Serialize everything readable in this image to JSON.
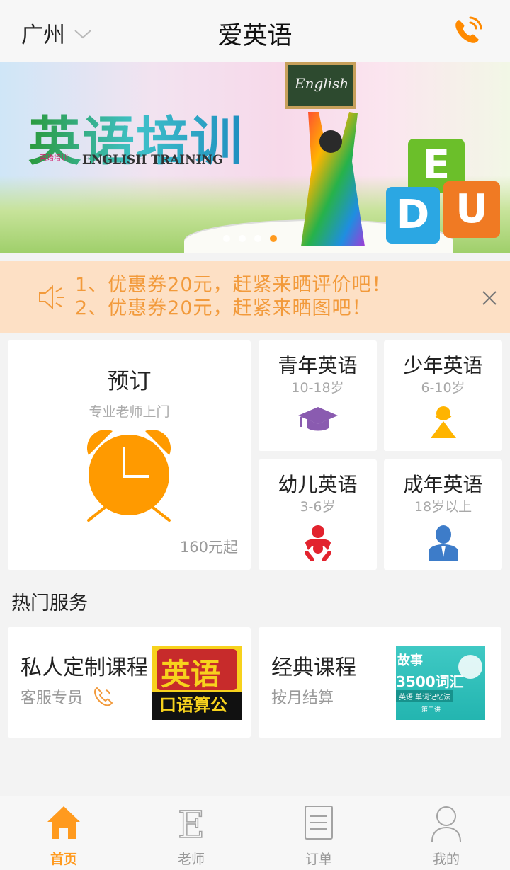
{
  "header": {
    "city": "广州",
    "title": "爱英语"
  },
  "banner": {
    "headline": "英语培训",
    "subtitle": "ENGLISH TRAINING",
    "small_text": "英语培训",
    "board_text": "English",
    "cube_letters": [
      "E",
      "D",
      "U"
    ],
    "slide_count": 4,
    "active_slide": 4
  },
  "notice": {
    "lines": [
      "1、优惠券20元，赶紧来晒评价吧！",
      "2、优惠券20元，赶紧来晒图吧！"
    ]
  },
  "booking": {
    "title": "预订",
    "subtitle": "专业老师上门",
    "price": "160元起"
  },
  "categories": [
    {
      "title": "青年英语",
      "age": "10-18岁",
      "icon": "graduation-cap-icon"
    },
    {
      "title": "少年英语",
      "age": "6-10岁",
      "icon": "child-icon"
    },
    {
      "title": "幼儿英语",
      "age": "3-6岁",
      "icon": "baby-icon"
    },
    {
      "title": "成年英语",
      "age": "18岁以上",
      "icon": "adult-icon"
    }
  ],
  "hot_services": {
    "title": "热门服务",
    "items": [
      {
        "title": "私人定制课程",
        "sub": "客服专员",
        "thumb_text": [
          "英语",
          "口语算公"
        ]
      },
      {
        "title": "经典课程",
        "sub": "按月结算",
        "thumb_text": [
          "故事",
          "3500词汇",
          "英语 单词记忆法",
          "第二讲"
        ]
      }
    ]
  },
  "tabbar": {
    "items": [
      {
        "label": "首页",
        "icon": "home-icon",
        "active": true
      },
      {
        "label": "老师",
        "icon": "teacher-icon",
        "active": false
      },
      {
        "label": "订单",
        "icon": "order-icon",
        "active": false
      },
      {
        "label": "我的",
        "icon": "profile-icon",
        "active": false
      }
    ]
  },
  "colors": {
    "accent": "#ff9a1e",
    "notice_bg": "#fde0c5",
    "notice_text": "#f29a3b",
    "cap_purple": "#8a5bb0",
    "baby_red": "#e2232e",
    "adult_blue": "#3d7cc9"
  }
}
